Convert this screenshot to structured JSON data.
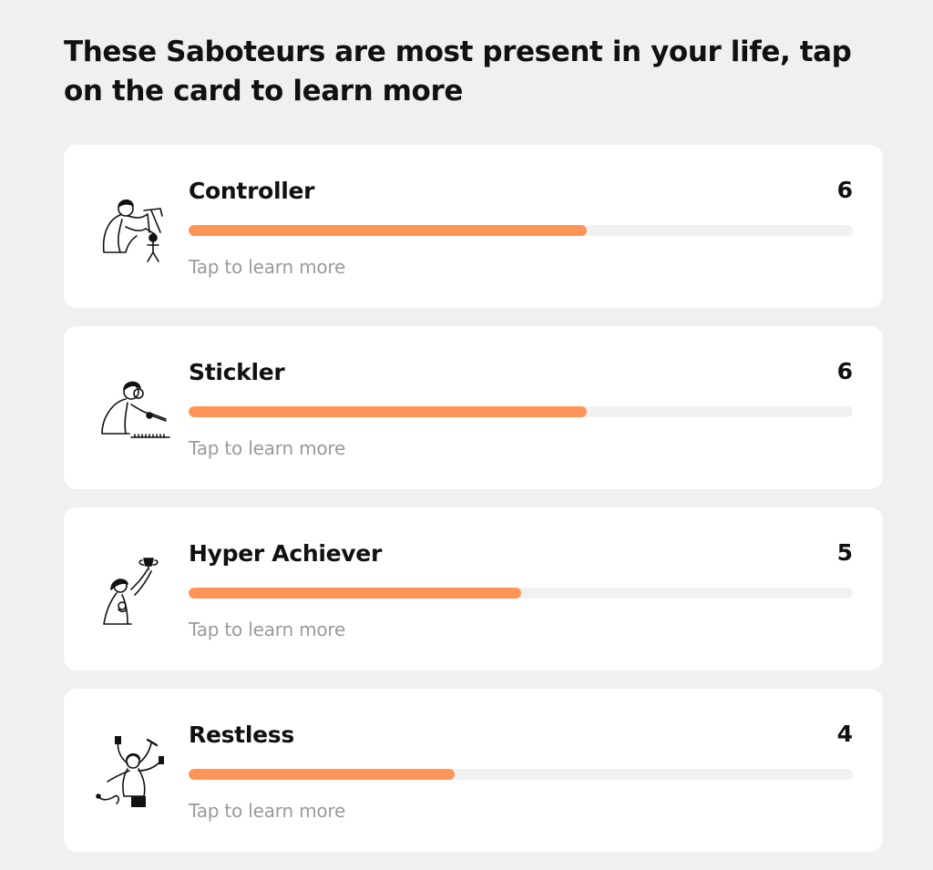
{
  "heading": "These Saboteurs are most present in your life, tap on the card to learn more",
  "colors": {
    "page_background": "#f0f0f0",
    "card_background": "#ffffff",
    "bar_fill": "#ff9457",
    "bar_track": "#f1f1f1",
    "muted_text": "#9a9a9a"
  },
  "score_max": 10,
  "cards": [
    {
      "name": "Controller",
      "score": "6",
      "level": 0.6,
      "cta": "Tap to learn more",
      "icon": "controller-illustration-icon"
    },
    {
      "name": "Stickler",
      "score": "6",
      "level": 0.6,
      "cta": "Tap to learn more",
      "icon": "stickler-illustration-icon"
    },
    {
      "name": "Hyper Achiever",
      "score": "5",
      "level": 0.5,
      "cta": "Tap to learn more",
      "icon": "hyper-achiever-illustration-icon"
    },
    {
      "name": "Restless",
      "score": "4",
      "level": 0.4,
      "cta": "Tap to learn more",
      "icon": "restless-illustration-icon"
    }
  ]
}
